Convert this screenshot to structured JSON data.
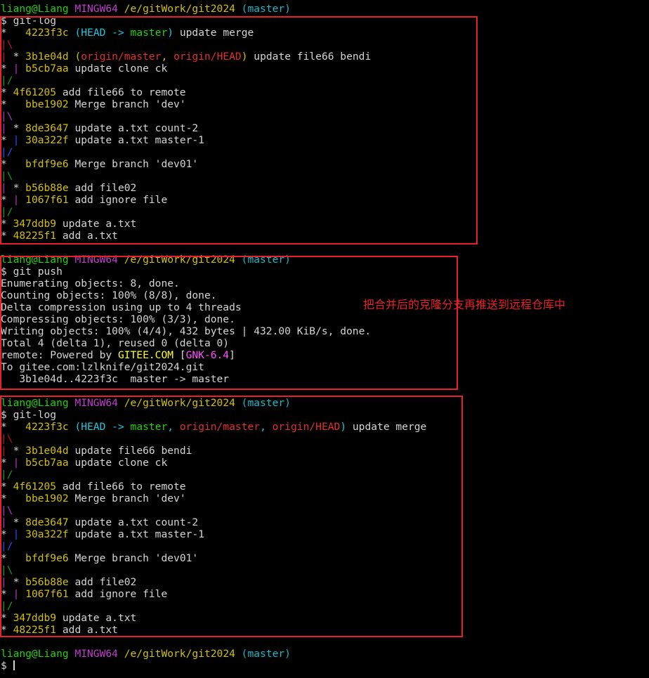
{
  "colors": {
    "default": "#d4d4d4",
    "user": "#23d100",
    "mingw": "#c03ccd",
    "path": "#d2c000",
    "branch": "#13b9c8",
    "hash": "#d2c000",
    "head": "#1ec8dc",
    "master": "#23d100",
    "origin": "#e0302c",
    "gitee": "#ffff1e",
    "gnk": "#ff50ff",
    "graph_green": "#13a10e",
    "graph_red": "#c50f1f",
    "graph_magenta": "#b330c0",
    "graph_blue": "#2050ff",
    "annotation": "#e8202a"
  },
  "annotation": "把合并后的克隆分支再推送到远程仓库中",
  "lines": [
    {
      "segs": [
        [
          "liang@Liang ",
          "user"
        ],
        [
          "MINGW64 ",
          "mingw"
        ],
        [
          "/e/gitWork/git2024 ",
          "path"
        ],
        [
          "(master)",
          "branch"
        ]
      ]
    },
    {
      "segs": [
        [
          "$ git-log",
          "default"
        ]
      ]
    },
    {
      "segs": [
        [
          "*   ",
          "default"
        ],
        [
          "4223f3c ",
          "hash"
        ],
        [
          "(",
          "head"
        ],
        [
          "HEAD -> ",
          "head"
        ],
        [
          "master",
          "master"
        ],
        [
          ")",
          "head"
        ],
        [
          " update merge",
          "default"
        ]
      ]
    },
    {
      "segs": [
        [
          "|\\",
          "graph_red"
        ]
      ]
    },
    {
      "segs": [
        [
          "|",
          "graph_red"
        ],
        [
          " * ",
          "default"
        ],
        [
          "3b1e04d ",
          "hash"
        ],
        [
          "(",
          "hash"
        ],
        [
          "origin/master",
          "origin"
        ],
        [
          ", ",
          "hash"
        ],
        [
          "origin/HEAD",
          "origin"
        ],
        [
          ")",
          "hash"
        ],
        [
          " update file66 bendi",
          "default"
        ]
      ]
    },
    {
      "segs": [
        [
          "* ",
          "default"
        ],
        [
          "| ",
          "graph_magenta"
        ],
        [
          "b5cb7aa ",
          "hash"
        ],
        [
          "update clone ck",
          "default"
        ]
      ]
    },
    {
      "segs": [
        [
          "|/",
          "graph_green"
        ]
      ]
    },
    {
      "segs": [
        [
          "* ",
          "default"
        ],
        [
          "4f61205 ",
          "hash"
        ],
        [
          "add file66 to remote",
          "default"
        ]
      ]
    },
    {
      "segs": [
        [
          "*   ",
          "default"
        ],
        [
          "bbe1902 ",
          "hash"
        ],
        [
          "Merge branch 'dev'",
          "default"
        ]
      ]
    },
    {
      "segs": [
        [
          "|\\",
          "graph_magenta"
        ]
      ]
    },
    {
      "segs": [
        [
          "|",
          "graph_magenta"
        ],
        [
          " * ",
          "default"
        ],
        [
          "8de3647 ",
          "hash"
        ],
        [
          "update a.txt count-2",
          "default"
        ]
      ]
    },
    {
      "segs": [
        [
          "* ",
          "default"
        ],
        [
          "| ",
          "graph_blue"
        ],
        [
          "30a322f ",
          "hash"
        ],
        [
          "update a.txt master-1",
          "default"
        ]
      ]
    },
    {
      "segs": [
        [
          "|/",
          "graph_blue"
        ]
      ]
    },
    {
      "segs": [
        [
          "*   ",
          "default"
        ],
        [
          "bfdf9e6 ",
          "hash"
        ],
        [
          "Merge branch 'dev01'",
          "default"
        ]
      ]
    },
    {
      "segs": [
        [
          "|\\",
          "graph_green"
        ]
      ]
    },
    {
      "segs": [
        [
          "|",
          "graph_magenta"
        ],
        [
          " * ",
          "default"
        ],
        [
          "b56b88e ",
          "hash"
        ],
        [
          "add file02",
          "default"
        ]
      ]
    },
    {
      "segs": [
        [
          "* ",
          "default"
        ],
        [
          "| ",
          "graph_magenta"
        ],
        [
          "1067f61 ",
          "hash"
        ],
        [
          "add ignore file",
          "default"
        ]
      ]
    },
    {
      "segs": [
        [
          "|/",
          "graph_green"
        ]
      ]
    },
    {
      "segs": [
        [
          "* ",
          "default"
        ],
        [
          "347ddb9 ",
          "hash"
        ],
        [
          "update a.txt",
          "default"
        ]
      ]
    },
    {
      "segs": [
        [
          "* ",
          "default"
        ],
        [
          "48225f1 ",
          "hash"
        ],
        [
          "add a.txt",
          "default"
        ]
      ]
    },
    {
      "segs": []
    },
    {
      "segs": [
        [
          "liang@Liang ",
          "user"
        ],
        [
          "MINGW64 ",
          "mingw"
        ],
        [
          "/e/gitWork/git2024 ",
          "path"
        ],
        [
          "(master)",
          "branch"
        ]
      ]
    },
    {
      "segs": [
        [
          "$ git push",
          "default"
        ]
      ]
    },
    {
      "segs": [
        [
          "Enumerating objects: 8, done.",
          "default"
        ]
      ]
    },
    {
      "segs": [
        [
          "Counting objects: 100% (8/8), done.",
          "default"
        ]
      ]
    },
    {
      "segs": [
        [
          "Delta compression using up to 4 threads",
          "default"
        ]
      ]
    },
    {
      "segs": [
        [
          "Compressing objects: 100% (3/3), done.",
          "default"
        ]
      ]
    },
    {
      "segs": [
        [
          "Writing objects: 100% (4/4), 432 bytes | 432.00 KiB/s, done.",
          "default"
        ]
      ]
    },
    {
      "segs": [
        [
          "Total 4 (delta 1), reused 0 (delta 0)",
          "default"
        ]
      ]
    },
    {
      "segs": [
        [
          "remote: Powered by ",
          "default"
        ],
        [
          "GITEE.COM",
          "gitee"
        ],
        [
          " [",
          "default"
        ],
        [
          "GNK-6.4",
          "gnk"
        ],
        [
          "]",
          "default"
        ]
      ]
    },
    {
      "segs": [
        [
          "To gitee.com:lzlknife/git2024.git",
          "default"
        ]
      ]
    },
    {
      "segs": [
        [
          "   3b1e04d..4223f3c  master -> master",
          "default"
        ]
      ]
    },
    {
      "segs": []
    },
    {
      "segs": [
        [
          "liang@Liang ",
          "user"
        ],
        [
          "MINGW64 ",
          "mingw"
        ],
        [
          "/e/gitWork/git2024 ",
          "path"
        ],
        [
          "(master)",
          "branch"
        ]
      ]
    },
    {
      "segs": [
        [
          "$ git-log",
          "default"
        ]
      ]
    },
    {
      "segs": [
        [
          "*   ",
          "default"
        ],
        [
          "4223f3c ",
          "hash"
        ],
        [
          "(",
          "head"
        ],
        [
          "HEAD -> ",
          "head"
        ],
        [
          "master",
          "master"
        ],
        [
          ", ",
          "head"
        ],
        [
          "origin/master",
          "origin"
        ],
        [
          ", ",
          "head"
        ],
        [
          "origin/HEAD",
          "origin"
        ],
        [
          ")",
          "head"
        ],
        [
          " update merge",
          "default"
        ]
      ]
    },
    {
      "segs": [
        [
          "|\\",
          "graph_red"
        ]
      ]
    },
    {
      "segs": [
        [
          "|",
          "graph_red"
        ],
        [
          " * ",
          "default"
        ],
        [
          "3b1e04d ",
          "hash"
        ],
        [
          "update file66 bendi",
          "default"
        ]
      ]
    },
    {
      "segs": [
        [
          "* ",
          "default"
        ],
        [
          "| ",
          "graph_magenta"
        ],
        [
          "b5cb7aa ",
          "hash"
        ],
        [
          "update clone ck",
          "default"
        ]
      ]
    },
    {
      "segs": [
        [
          "|/",
          "graph_green"
        ]
      ]
    },
    {
      "segs": [
        [
          "* ",
          "default"
        ],
        [
          "4f61205 ",
          "hash"
        ],
        [
          "add file66 to remote",
          "default"
        ]
      ]
    },
    {
      "segs": [
        [
          "*   ",
          "default"
        ],
        [
          "bbe1902 ",
          "hash"
        ],
        [
          "Merge branch 'dev'",
          "default"
        ]
      ]
    },
    {
      "segs": [
        [
          "|\\",
          "graph_magenta"
        ]
      ]
    },
    {
      "segs": [
        [
          "|",
          "graph_magenta"
        ],
        [
          " * ",
          "default"
        ],
        [
          "8de3647 ",
          "hash"
        ],
        [
          "update a.txt count-2",
          "default"
        ]
      ]
    },
    {
      "segs": [
        [
          "* ",
          "default"
        ],
        [
          "| ",
          "graph_blue"
        ],
        [
          "30a322f ",
          "hash"
        ],
        [
          "update a.txt master-1",
          "default"
        ]
      ]
    },
    {
      "segs": [
        [
          "|/",
          "graph_blue"
        ]
      ]
    },
    {
      "segs": [
        [
          "*   ",
          "default"
        ],
        [
          "bfdf9e6 ",
          "hash"
        ],
        [
          "Merge branch 'dev01'",
          "default"
        ]
      ]
    },
    {
      "segs": [
        [
          "|\\",
          "graph_green"
        ]
      ]
    },
    {
      "segs": [
        [
          "|",
          "graph_magenta"
        ],
        [
          " * ",
          "default"
        ],
        [
          "b56b88e ",
          "hash"
        ],
        [
          "add file02",
          "default"
        ]
      ]
    },
    {
      "segs": [
        [
          "* ",
          "default"
        ],
        [
          "| ",
          "graph_magenta"
        ],
        [
          "1067f61 ",
          "hash"
        ],
        [
          "add ignore file",
          "default"
        ]
      ]
    },
    {
      "segs": [
        [
          "|/",
          "graph_green"
        ]
      ]
    },
    {
      "segs": [
        [
          "* ",
          "default"
        ],
        [
          "347ddb9 ",
          "hash"
        ],
        [
          "update a.txt",
          "default"
        ]
      ]
    },
    {
      "segs": [
        [
          "* ",
          "default"
        ],
        [
          "48225f1 ",
          "hash"
        ],
        [
          "add a.txt",
          "default"
        ]
      ]
    },
    {
      "segs": []
    },
    {
      "segs": [
        [
          "liang@Liang ",
          "user"
        ],
        [
          "MINGW64 ",
          "mingw"
        ],
        [
          "/e/gitWork/git2024 ",
          "path"
        ],
        [
          "(master)",
          "branch"
        ]
      ]
    },
    {
      "segs": [
        [
          "$ ",
          "default"
        ]
      ],
      "cursor": true
    }
  ]
}
